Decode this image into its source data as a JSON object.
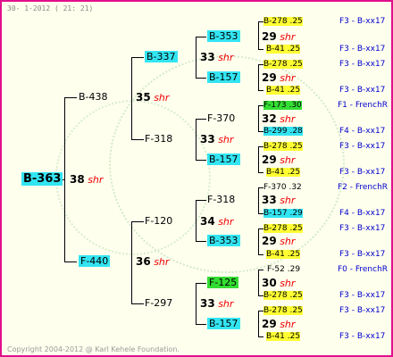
{
  "header": {
    "date": "30- 1-2012 ( 21: 21)"
  },
  "footer": {
    "copyright": "Copyright 2004-2012 @ Karl Kehele Foundation."
  },
  "g0": {
    "name": "B-363",
    "score": "38",
    "label": "shr"
  },
  "g1": [
    {
      "name": "B-438",
      "score": "35",
      "label": "shr"
    },
    {
      "name": "F-440",
      "score": "36",
      "label": "shr"
    }
  ],
  "g2": [
    {
      "name": "B-337",
      "score": "33",
      "label": "shr"
    },
    {
      "name": "F-318",
      "score": "33",
      "label": "shr"
    },
    {
      "name": "F-120",
      "score": "34",
      "label": "shr"
    },
    {
      "name": "F-297",
      "score": "33",
      "label": "shr"
    }
  ],
  "g3": [
    {
      "name": "B-353",
      "score": "29",
      "label": "shr"
    },
    {
      "name": "B-157",
      "score": "29",
      "label": "shr"
    },
    {
      "name": "F-370",
      "score": "32",
      "label": "shr"
    },
    {
      "name": "B-157",
      "score": "29",
      "label": "shr"
    },
    {
      "name": "F-318",
      "score": "33",
      "label": "shr"
    },
    {
      "name": "B-353",
      "score": "29",
      "label": "shr"
    },
    {
      "name": "F-125",
      "score": "30",
      "label": "shr"
    },
    {
      "name": "B-157",
      "score": "29",
      "label": "shr"
    }
  ],
  "g4": [
    {
      "name": "B-278 .25",
      "group": "F3 - B-xx17"
    },
    {
      "name": "B-41 .25",
      "group": "F3 - B-xx17"
    },
    {
      "name": "B-278 .25",
      "group": "F3 - B-xx17"
    },
    {
      "name": "B-41 .25",
      "group": "F3 - B-xx17"
    },
    {
      "name": "F-173 .30",
      "group": "F1 - FrenchR"
    },
    {
      "name": "B-299 .28",
      "group": "F4 - B-xx17"
    },
    {
      "name": "B-278 .25",
      "group": "F3 - B-xx17"
    },
    {
      "name": "B-41 .25",
      "group": "F3 - B-xx17"
    },
    {
      "name": "F-370 .32",
      "group": "F2 - FrenchR"
    },
    {
      "name": "B-157 .29",
      "group": "F4 - B-xx17"
    },
    {
      "name": "B-278 .25",
      "group": "F3 - B-xx17"
    },
    {
      "name": "B-41 .25",
      "group": "F3 - B-xx17"
    },
    {
      "name": "F-52 .29",
      "group": "F0 - FrenchR"
    },
    {
      "name": "B-278 .25",
      "group": "F3 - B-xx17"
    },
    {
      "name": "B-278 .25",
      "group": "F3 - B-xx17"
    },
    {
      "name": "B-41 .25",
      "group": "F3 - B-xx17"
    }
  ],
  "colors": {
    "frame": "#e0108c",
    "cyan": "#33e5f2",
    "green": "#33dd33",
    "yellow": "#ffff33",
    "shr": "#e00000",
    "group": "#0000cc"
  }
}
